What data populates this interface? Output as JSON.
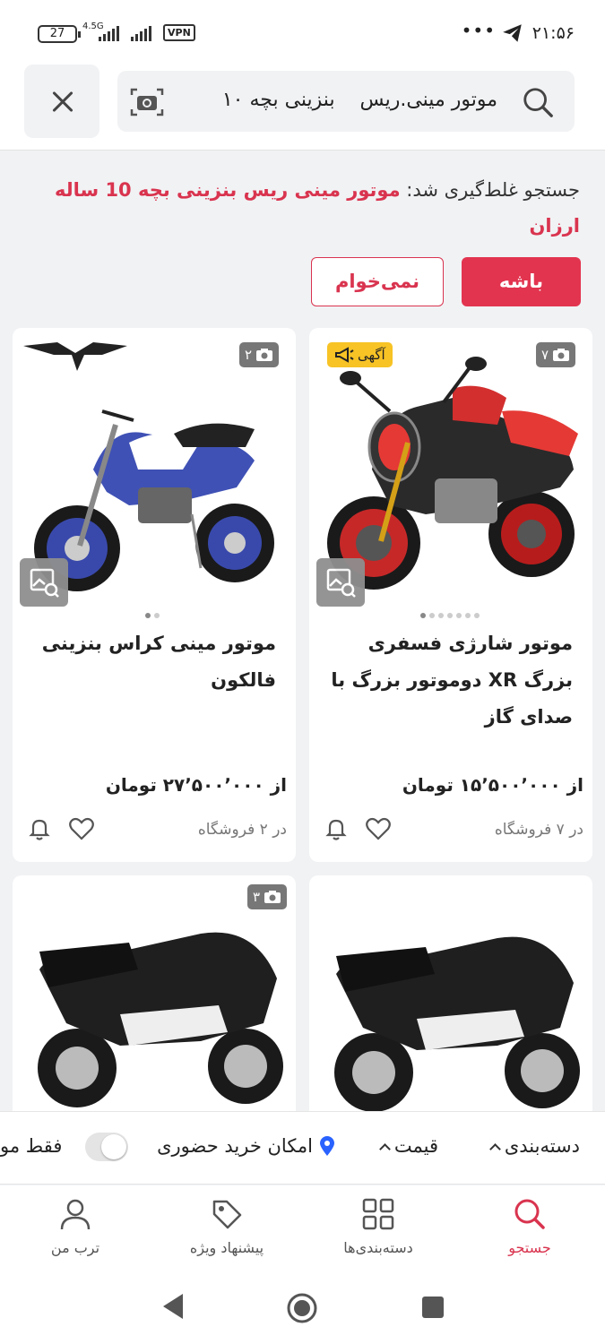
{
  "status_bar": {
    "time": "۲۱:۵۶",
    "battery": "27",
    "network": "4.5G",
    "vpn": "VPN",
    "overflow": "•••"
  },
  "search": {
    "query": "موتور مینی.ریس    بنزینی بچه ۱۰"
  },
  "correction": {
    "prefix": "جستجو غلط‌گیری شد:",
    "corrected": "موتور مینی ریس بنزینی بچه 10 ساله ارزان",
    "yes_label": "باشه",
    "no_label": "نمی‌خوام"
  },
  "products": [
    {
      "title": "موتور شارژی فسفری بزرگ XR دوموتور بزرگ با صدای گاز",
      "price": "از ۱۵٬۵۰۰٬۰۰۰ تومان",
      "stores": "در ۷ فروشگاه",
      "photo_count": "۷",
      "ad_label": "آگهی"
    },
    {
      "title": "موتور مینی کراس بنزینی فالکون",
      "price": "از ۲۷٬۵۰۰٬۰۰۰ تومان",
      "stores": "در ۲ فروشگاه",
      "photo_count": "۲"
    },
    {
      "photo_count": ""
    },
    {
      "photo_count": "۳"
    }
  ],
  "filters": {
    "category": "دسته‌بندی",
    "price": "قیمت",
    "in_person": "امکان خرید حضوری",
    "only": "فقط مو"
  },
  "bottom_nav": {
    "search": "جستجو",
    "categories": "دسته‌بندی‌ها",
    "offers": "پیشنهاد ویژه",
    "profile": "ترب من"
  },
  "colors": {
    "accent": "#e2344f",
    "ad_badge": "#f7c325"
  }
}
